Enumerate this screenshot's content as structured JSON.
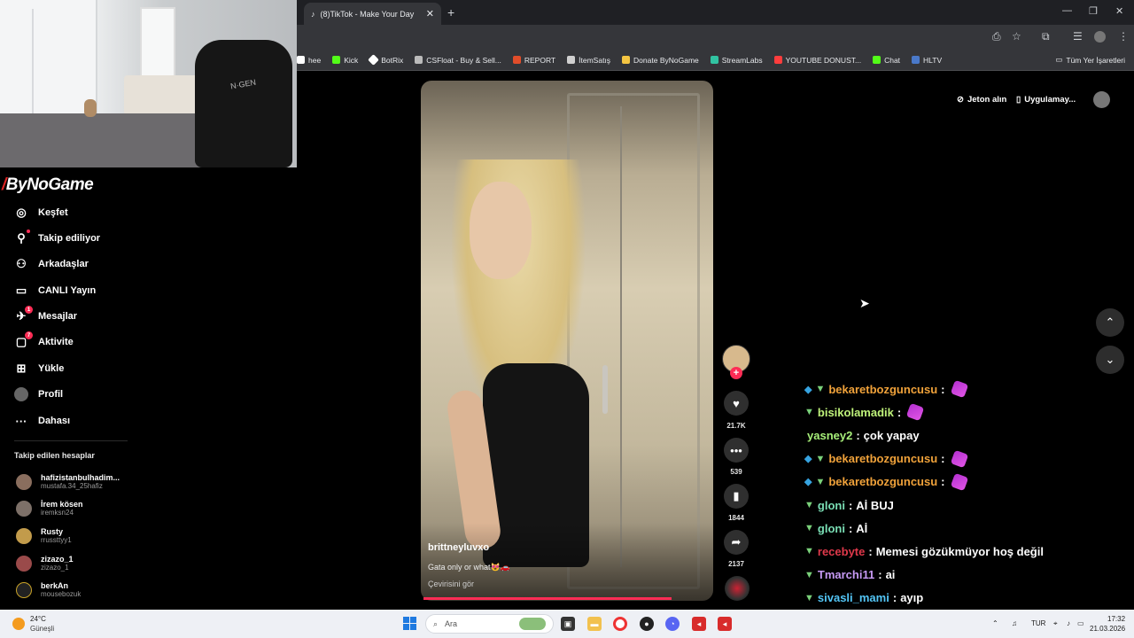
{
  "browser": {
    "tab_title": "(8)TikTok - Make Your Day",
    "tab_close": "✕",
    "new_tab": "+",
    "window_controls": {
      "minimize": "—",
      "restore": "❐",
      "close": "✕"
    },
    "bookmarks": [
      {
        "label": "hee",
        "color": "#ffffff"
      },
      {
        "label": "Kick",
        "color": "#53fc18"
      },
      {
        "label": "BotRix",
        "color": "#ffffff"
      },
      {
        "label": "CSFloat - Buy & Sell...",
        "color": "#ffffff"
      },
      {
        "label": "REPORT",
        "color": "#e14d2a"
      },
      {
        "label": "İtemSatış",
        "color": "#d0d0d0"
      },
      {
        "label": "Donate ByNoGame",
        "color": "#f4c542"
      },
      {
        "label": "StreamLabs",
        "color": "#31c3a2"
      },
      {
        "label": "YOUTUBE DONUST...",
        "color": "#ff3d3d"
      },
      {
        "label": "Chat",
        "color": "#53fc18"
      },
      {
        "label": "HLTV",
        "color": "#4a79c9"
      }
    ],
    "all_bookmarks": "Tüm Yer İşaretleri"
  },
  "overlay": {
    "logo_prefix": "ByNo",
    "logo_suffix": "Game"
  },
  "sidebar": {
    "items": [
      {
        "label": "Keşfet",
        "icon": "compass-icon",
        "glyph": "◎"
      },
      {
        "label": "Takip ediliyor",
        "icon": "following-icon",
        "glyph": "⚲"
      },
      {
        "label": "Arkadaşlar",
        "icon": "friends-icon",
        "glyph": "⚇"
      },
      {
        "label": "CANLI Yayın",
        "icon": "live-icon",
        "glyph": "▭"
      },
      {
        "label": "Mesajlar",
        "icon": "messages-icon",
        "glyph": "✈",
        "badge": "1"
      },
      {
        "label": "Aktivite",
        "icon": "activity-icon",
        "glyph": "▢",
        "badge": "7"
      },
      {
        "label": "Yükle",
        "icon": "upload-icon",
        "glyph": "⊞"
      },
      {
        "label": "Profil",
        "icon": "profile-icon",
        "glyph": "●"
      },
      {
        "label": "Dahası",
        "icon": "more-icon",
        "glyph": "···"
      }
    ],
    "following_title": "Takip edilen hesaplar",
    "accounts": [
      {
        "name": "hafizistanbulhadim...",
        "handle": "mustafa.34_25hafiz"
      },
      {
        "name": "İrem kösen",
        "handle": "iremksn24"
      },
      {
        "name": "Rusty",
        "handle": "rrussttyy1"
      },
      {
        "name": "zizazo_1",
        "handle": "zizazo_1"
      },
      {
        "name": "berkAn",
        "handle": "mousebozuk"
      }
    ]
  },
  "video": {
    "author": "brittneyluvxo",
    "caption": "Gata only or what😻🚗",
    "translate": "Çevirisini gör",
    "follow_plus": "+",
    "likes": "21.7K",
    "comments": "539",
    "saves": "1844",
    "shares": "2137"
  },
  "header_buttons": {
    "coins": "Jeton alın",
    "app": "Uygulamay..."
  },
  "nav_arrows": {
    "up": "⌃",
    "down": "⌄"
  },
  "chat": [
    {
      "badges": [
        "cube",
        "v"
      ],
      "user": "bekaretbozguncusu",
      "color": "#f0a23a",
      "text": "",
      "emote": true
    },
    {
      "badges": [
        "v"
      ],
      "user": "bisikolamadik",
      "color": "#bff27a",
      "text": "",
      "emote": true
    },
    {
      "badges": [],
      "user": "yasney2",
      "color": "#a8f07a",
      "text": "çok yapay",
      "emote": false
    },
    {
      "badges": [
        "cube",
        "v"
      ],
      "user": "bekaretbozguncusu",
      "color": "#f0a23a",
      "text": "",
      "emote": true
    },
    {
      "badges": [
        "cube",
        "v"
      ],
      "user": "bekaretbozguncusu",
      "color": "#f0a23a",
      "text": "",
      "emote": true
    },
    {
      "badges": [
        "v"
      ],
      "user": "gloni",
      "color": "#7adfb5",
      "text": "Aİ BUJ",
      "emote": false
    },
    {
      "badges": [
        "v"
      ],
      "user": "gloni",
      "color": "#7adfb5",
      "text": "Aİ",
      "emote": false
    },
    {
      "badges": [
        "v"
      ],
      "user": "recebyte",
      "color": "#e0394b",
      "text": "Memesi gözükmüyor hoş değil",
      "emote": false
    },
    {
      "badges": [
        "v"
      ],
      "user": "Tmarchi11",
      "color": "#c79af5",
      "text": "ai",
      "emote": false
    },
    {
      "badges": [
        "v"
      ],
      "user": "sivasli_mami",
      "color": "#53c5f5",
      "text": "ayıp",
      "emote": false
    }
  ],
  "webcam": {
    "chair_brand": "N·GEN"
  },
  "taskbar": {
    "temp": "24°C",
    "weather": "Güneşli",
    "search_placeholder": "Ara",
    "lang": "TUR",
    "time": "17:32",
    "date": "21.03.2026"
  }
}
